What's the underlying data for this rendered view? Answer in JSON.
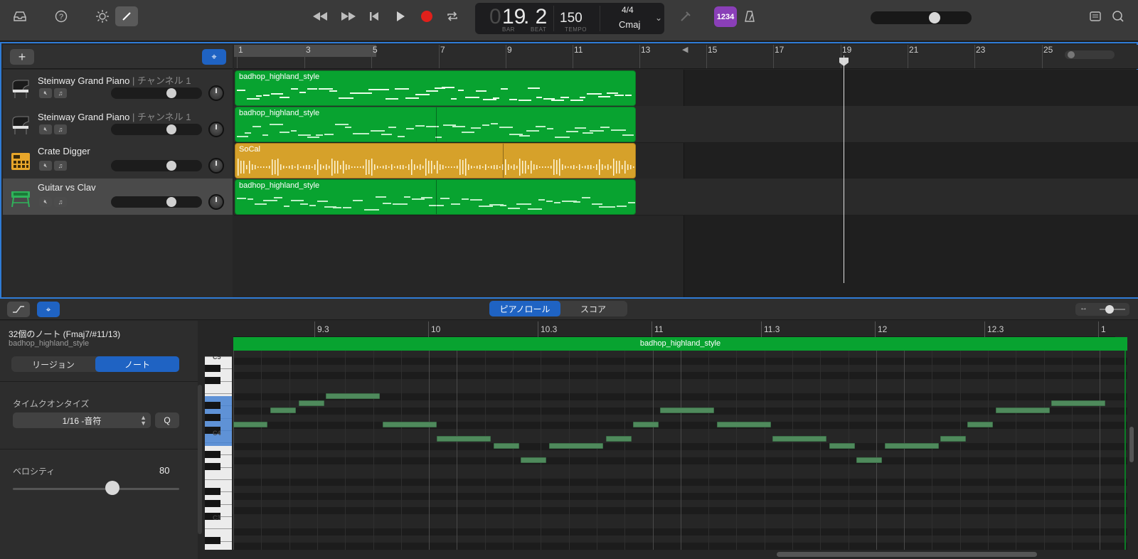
{
  "toolbar": {
    "lcd": {
      "bar": "19",
      "bar_prefix": "0",
      "beat": ". 2",
      "bar_label": "BAR",
      "beat_label": "BEAT",
      "tempo": "150",
      "tempo_label": "TEMPO",
      "time_sig": "4/4",
      "key": "Cmaj"
    },
    "count_in": "1234",
    "icons": [
      "library-icon",
      "help-icon",
      "brightness-icon",
      "pencil-icon",
      "rewind-icon",
      "fast-forward-icon",
      "skip-back-icon",
      "play-icon",
      "record-icon",
      "cycle-icon",
      "tuner-icon",
      "metronome-icon",
      "notepad-icon",
      "search-icon"
    ],
    "colors": {
      "record": "#e0201b",
      "count_in": "#8a3fb8",
      "selection": "#2f7bd6"
    },
    "master_volume": 0.65
  },
  "ruler": {
    "bars": [
      "1",
      "3",
      "5",
      "7",
      "9",
      "11",
      "13",
      "15",
      "17",
      "19",
      "21",
      "23",
      "25"
    ]
  },
  "tracks": [
    {
      "name": "Steinway Grand Piano",
      "channel": "| チャンネル 1",
      "icon": "grand-piano-icon",
      "volume": 0.68
    },
    {
      "name": "Steinway Grand Piano",
      "channel": "| チャンネル 1",
      "icon": "grand-piano-icon",
      "volume": 0.68
    },
    {
      "name": "Crate Digger",
      "channel": "",
      "icon": "drum-machine-icon",
      "volume": 0.68
    },
    {
      "name": "Guitar vs Clav",
      "channel": "",
      "icon": "keyboard-icon",
      "volume": 0.68
    }
  ],
  "regions": [
    {
      "name": "badhop_highland_style"
    },
    {
      "name": "badhop_highland_style"
    },
    {
      "name": "SoCal"
    },
    {
      "name": "badhop_highland_style"
    }
  ],
  "editor": {
    "tabs": [
      "ピアノロール",
      "スコア"
    ],
    "active_tab": "ピアノロール",
    "inspector": {
      "title": "32個のノート (Fmaj7/#11/13)",
      "subtitle": "badhop_highland_style",
      "seg": [
        "リージョン",
        "ノート"
      ],
      "quantize_label": "タイムクオンタイズ",
      "quantize_value": "1/16 -音符",
      "quantize_button": "Q",
      "velocity_label": "ベロシティ",
      "velocity_value": "80",
      "velocity_fraction": 0.6
    },
    "ruler": [
      "9.3",
      "10",
      "10.3",
      "11",
      "11.3",
      "12",
      "12.3",
      "1"
    ],
    "region_name": "badhop_highland_style",
    "key_labels": [
      "C5",
      "C4",
      "C3"
    ]
  }
}
